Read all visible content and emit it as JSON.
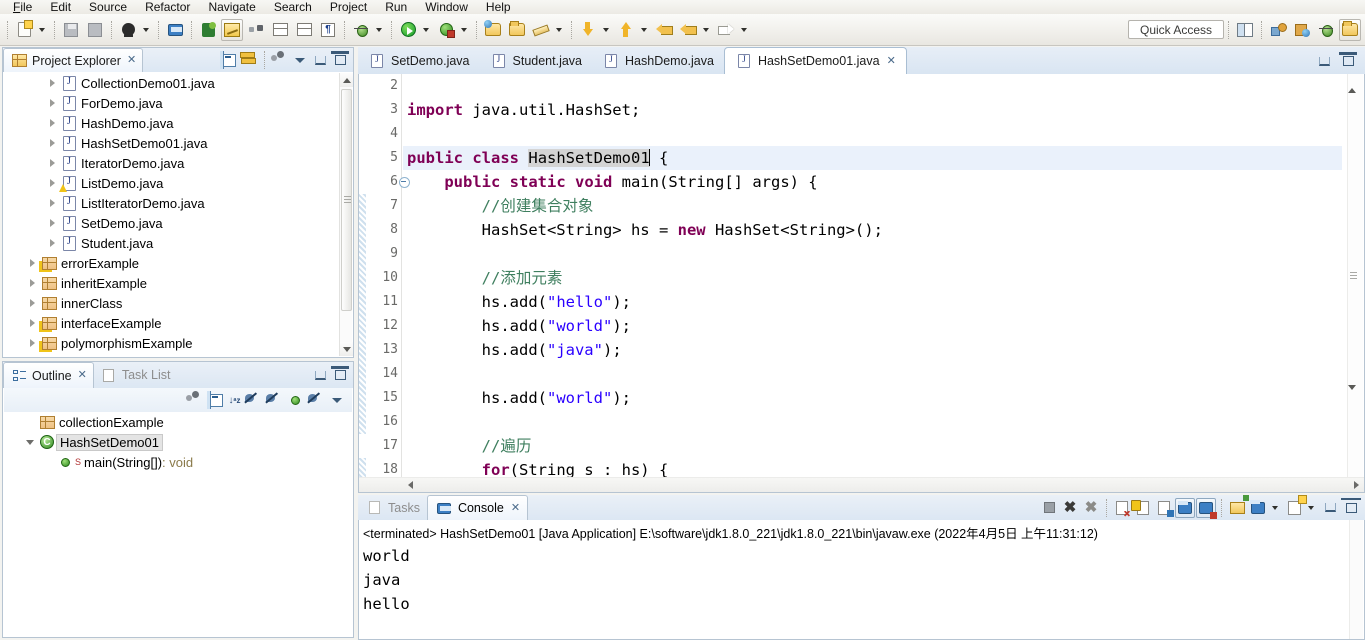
{
  "menubar": {
    "items": [
      "File",
      "Edit",
      "Source",
      "Refactor",
      "Navigate",
      "Search",
      "Project",
      "Run",
      "Window",
      "Help"
    ]
  },
  "toolbar": {
    "quick_access_placeholder": "Quick Access",
    "icons": [
      "new-wizard-icon",
      "save-icon",
      "save-all-icon",
      "person-icon",
      "console-icon",
      "pin-console-icon",
      "edit-yellow-icon",
      "dots-icon",
      "import-icon",
      "table-icon",
      "paragraph-icon",
      "debug-bug-icon",
      "run-icon",
      "run-last-icon",
      "open-type-icon",
      "open-task-icon",
      "pencil-icon",
      "next-annotation-icon",
      "previous-annotation-icon",
      "last-edit-location-icon",
      "back-icon",
      "forward-icon"
    ],
    "perspective_icons": [
      "new-perspective-icon",
      "java-ee-perspective-icon",
      "debug-perspective-icon",
      "java-perspective-icon"
    ]
  },
  "project_explorer": {
    "title": "Project Explorer",
    "close_glyph": "✕",
    "toolbar_icons": [
      "collapse-all-icon",
      "link-with-editor-icon",
      "view-menu-dots-icon",
      "view-menu-icon",
      "minimize-icon",
      "maximize-icon"
    ],
    "items": [
      {
        "label": "CollectionDemo01.java",
        "type": "java",
        "indent": 2,
        "warn": false
      },
      {
        "label": "ForDemo.java",
        "type": "java",
        "indent": 2,
        "warn": false
      },
      {
        "label": "HashDemo.java",
        "type": "java",
        "indent": 2,
        "warn": false
      },
      {
        "label": "HashSetDemo01.java",
        "type": "java",
        "indent": 2,
        "warn": false
      },
      {
        "label": "IteratorDemo.java",
        "type": "java",
        "indent": 2,
        "warn": false
      },
      {
        "label": "ListDemo.java",
        "type": "java",
        "indent": 2,
        "warn": true
      },
      {
        "label": "ListIteratorDemo.java",
        "type": "java",
        "indent": 2,
        "warn": false
      },
      {
        "label": "SetDemo.java",
        "type": "java",
        "indent": 2,
        "warn": false
      },
      {
        "label": "Student.java",
        "type": "java",
        "indent": 2,
        "warn": false
      },
      {
        "label": "errorExample",
        "type": "package",
        "indent": 1,
        "warn": true
      },
      {
        "label": "inheritExample",
        "type": "package",
        "indent": 1,
        "warn": false
      },
      {
        "label": "innerClass",
        "type": "package",
        "indent": 1,
        "warn": false
      },
      {
        "label": "interfaceExample",
        "type": "package",
        "indent": 1,
        "warn": true
      },
      {
        "label": "polymorphismExample",
        "type": "package",
        "indent": 1,
        "warn": true
      }
    ]
  },
  "outline": {
    "tabs": [
      {
        "label": "Outline",
        "active": true,
        "icon": "outline-icon"
      },
      {
        "label": "Task List",
        "active": false,
        "icon": "task-list-icon"
      }
    ],
    "close_glyph": "✕",
    "toolbar_icons": [
      "view-menu-dots-icon",
      "collapse-all-icon",
      "sort-icon",
      "hide-fields-icon",
      "hide-static-icon",
      "hide-nonpublic-icon",
      "hide-local-types-icon",
      "view-menu-icon"
    ],
    "items": [
      {
        "label": "collectionExample",
        "type": "package",
        "indent": 1
      },
      {
        "label": "HashSetDemo01",
        "type": "class",
        "indent": 1,
        "selected": true
      },
      {
        "label": "main(String[])",
        "suffix": " : void",
        "type": "method",
        "indent": 2
      }
    ]
  },
  "editor": {
    "tabs": [
      {
        "label": "SetDemo.java",
        "active": false
      },
      {
        "label": "Student.java",
        "active": false
      },
      {
        "label": "HashDemo.java",
        "active": false
      },
      {
        "label": "HashSetDemo01.java",
        "active": true,
        "close_glyph": "✕"
      }
    ],
    "window_icons": [
      "minimize-icon",
      "maximize-icon"
    ],
    "lines": [
      {
        "num": 2,
        "segments": []
      },
      {
        "num": 3,
        "segments": [
          {
            "t": "import",
            "c": "kw"
          },
          {
            "t": " java.util.HashSet;",
            "c": ""
          }
        ]
      },
      {
        "num": 4,
        "segments": []
      },
      {
        "num": 5,
        "current": true,
        "segments": [
          {
            "t": "public",
            "c": "kw"
          },
          {
            "t": " ",
            "c": ""
          },
          {
            "t": "class",
            "c": "kw"
          },
          {
            "t": " ",
            "c": ""
          },
          {
            "t": "HashSetDemo01",
            "c": "sel"
          },
          {
            "t": "|",
            "c": "caret"
          },
          {
            "t": " {",
            "c": ""
          }
        ]
      },
      {
        "num": 6,
        "fold": true,
        "segments": [
          {
            "t": "    ",
            "c": ""
          },
          {
            "t": "public",
            "c": "kw"
          },
          {
            "t": " ",
            "c": ""
          },
          {
            "t": "static",
            "c": "kw"
          },
          {
            "t": " ",
            "c": ""
          },
          {
            "t": "void",
            "c": "kw"
          },
          {
            "t": " main(String[] args) {",
            "c": ""
          }
        ]
      },
      {
        "num": 7,
        "segments": [
          {
            "t": "        ",
            "c": ""
          },
          {
            "t": "//创建集合对象",
            "c": "cmt"
          }
        ]
      },
      {
        "num": 8,
        "segments": [
          {
            "t": "        HashSet<String> hs = ",
            "c": ""
          },
          {
            "t": "new",
            "c": "kw"
          },
          {
            "t": " HashSet<String>();",
            "c": ""
          }
        ]
      },
      {
        "num": 9,
        "segments": []
      },
      {
        "num": 10,
        "segments": [
          {
            "t": "        ",
            "c": ""
          },
          {
            "t": "//添加元素",
            "c": "cmt"
          }
        ]
      },
      {
        "num": 11,
        "segments": [
          {
            "t": "        hs.add(",
            "c": ""
          },
          {
            "t": "\"hello\"",
            "c": "str"
          },
          {
            "t": ");",
            "c": ""
          }
        ]
      },
      {
        "num": 12,
        "segments": [
          {
            "t": "        hs.add(",
            "c": ""
          },
          {
            "t": "\"world\"",
            "c": "str"
          },
          {
            "t": ");",
            "c": ""
          }
        ]
      },
      {
        "num": 13,
        "segments": [
          {
            "t": "        hs.add(",
            "c": ""
          },
          {
            "t": "\"java\"",
            "c": "str"
          },
          {
            "t": ");",
            "c": ""
          }
        ]
      },
      {
        "num": 14,
        "segments": []
      },
      {
        "num": 15,
        "segments": [
          {
            "t": "        hs.add(",
            "c": ""
          },
          {
            "t": "\"world\"",
            "c": "str"
          },
          {
            "t": ");",
            "c": ""
          }
        ]
      },
      {
        "num": 16,
        "segments": []
      },
      {
        "num": 17,
        "segments": [
          {
            "t": "        ",
            "c": ""
          },
          {
            "t": "//遍历",
            "c": "cmt"
          }
        ]
      },
      {
        "num": 18,
        "segments": [
          {
            "t": "        ",
            "c": ""
          },
          {
            "t": "for",
            "c": "kw"
          },
          {
            "t": "(String s : hs) {",
            "c": ""
          }
        ]
      }
    ]
  },
  "console": {
    "tabs": [
      {
        "label": "Tasks",
        "active": false,
        "icon": "tasks-icon"
      },
      {
        "label": "Console",
        "active": true,
        "icon": "console-icon",
        "close_glyph": "✕"
      }
    ],
    "toolbar_icons": [
      "terminate-icon",
      "remove-launch-icon",
      "remove-all-terminated-icon",
      "clear-console-icon",
      "scroll-lock-icon",
      "word-wrap-icon",
      "show-console-on-output-icon",
      "show-console-on-error-icon",
      "open-console-icon",
      "display-selected-console-icon",
      "new-console-view-icon",
      "minimize-icon",
      "maximize-icon"
    ],
    "status_line": "<terminated> HashSetDemo01 [Java Application] E:\\software\\jdk1.8.0_221\\jdk1.8.0_221\\bin\\javaw.exe (2022年4月5日 上午11:31:12)",
    "output": [
      "world",
      "java",
      "hello"
    ]
  },
  "colors": {
    "keyword": "#7f0055",
    "string": "#2a00ff",
    "comment": "#3f7f5f",
    "current_line": "#eaf1fb",
    "selection": "#d4d4d4",
    "panel_border": "#b6c4d2"
  }
}
